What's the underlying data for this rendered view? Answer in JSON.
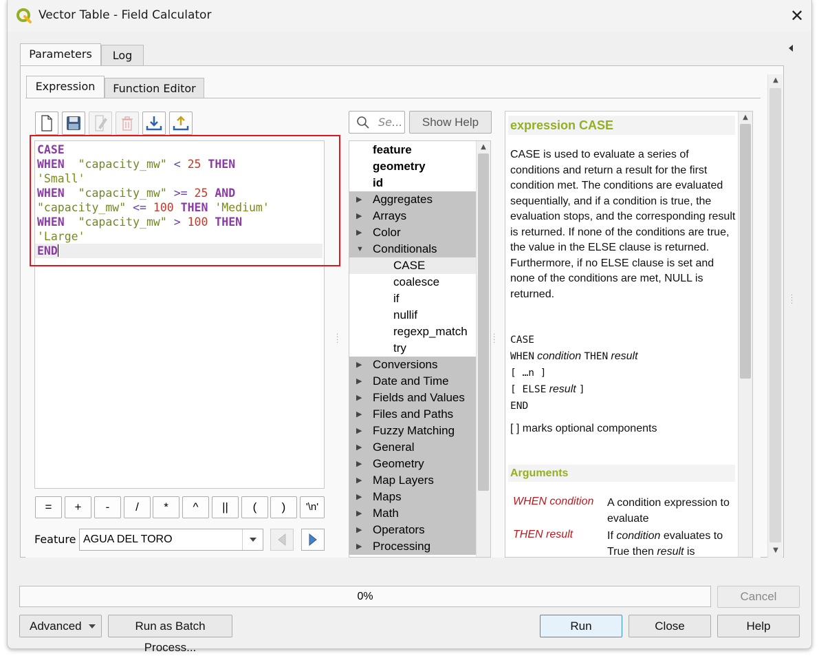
{
  "window": {
    "title": "Vector Table - Field Calculator",
    "close_glyph": "✕"
  },
  "tabs_outer": [
    {
      "label": "Parameters"
    },
    {
      "label": "Log"
    }
  ],
  "tabs_inner": [
    {
      "label": "Expression"
    },
    {
      "label": "Function Editor"
    }
  ],
  "toolbar_icons": [
    "new-file-icon",
    "save-icon",
    "edit-icon",
    "delete-icon",
    "import-icon",
    "export-icon"
  ],
  "expression": {
    "lines": [
      [
        {
          "t": "CASE",
          "c": "kw"
        }
      ],
      [
        {
          "t": "WHEN",
          "c": "kw"
        },
        {
          "t": "  ",
          "c": ""
        },
        {
          "t": "\"capacity_mw\"",
          "c": "fld"
        },
        {
          "t": " ",
          "c": ""
        },
        {
          "t": "<",
          "c": "op"
        },
        {
          "t": " ",
          "c": ""
        },
        {
          "t": "25",
          "c": "num"
        },
        {
          "t": " ",
          "c": ""
        },
        {
          "t": "THEN",
          "c": "kw"
        }
      ],
      [
        {
          "t": "'Small'",
          "c": "str"
        }
      ],
      [
        {
          "t": "WHEN",
          "c": "kw"
        },
        {
          "t": "  ",
          "c": ""
        },
        {
          "t": "\"capacity_mw\"",
          "c": "fld"
        },
        {
          "t": " ",
          "c": ""
        },
        {
          "t": ">=",
          "c": "op"
        },
        {
          "t": " ",
          "c": ""
        },
        {
          "t": "25",
          "c": "num"
        },
        {
          "t": " ",
          "c": ""
        },
        {
          "t": "AND",
          "c": "kw"
        }
      ],
      [
        {
          "t": "\"capacity_mw\"",
          "c": "fld"
        },
        {
          "t": " ",
          "c": ""
        },
        {
          "t": "<=",
          "c": "op"
        },
        {
          "t": " ",
          "c": ""
        },
        {
          "t": "100",
          "c": "num"
        },
        {
          "t": " ",
          "c": ""
        },
        {
          "t": "THEN",
          "c": "kw"
        },
        {
          "t": " ",
          "c": ""
        },
        {
          "t": "'Medium'",
          "c": "str"
        }
      ],
      [
        {
          "t": "WHEN",
          "c": "kw"
        },
        {
          "t": "  ",
          "c": ""
        },
        {
          "t": "\"capacity_mw\"",
          "c": "fld"
        },
        {
          "t": " ",
          "c": ""
        },
        {
          "t": ">",
          "c": "op"
        },
        {
          "t": " ",
          "c": ""
        },
        {
          "t": "100",
          "c": "num"
        },
        {
          "t": " ",
          "c": ""
        },
        {
          "t": "THEN",
          "c": "kw"
        }
      ],
      [
        {
          "t": "'Large'",
          "c": "str"
        }
      ],
      [
        {
          "t": "END",
          "c": "kw"
        }
      ]
    ]
  },
  "operators": [
    "=",
    "+",
    "-",
    "/",
    "*",
    "^",
    "||",
    "(",
    ")",
    "'\\n'"
  ],
  "feature": {
    "label": "Feature",
    "value": "AGUA DEL TORO"
  },
  "search": {
    "placeholder": "Se..."
  },
  "show_help_label": "Show Help",
  "function_tree": [
    {
      "label": "feature",
      "type": "bold"
    },
    {
      "label": "geometry",
      "type": "bold"
    },
    {
      "label": "id",
      "type": "bold"
    },
    {
      "label": "Aggregates",
      "type": "group",
      "expanded": false
    },
    {
      "label": "Arrays",
      "type": "group",
      "expanded": false
    },
    {
      "label": "Color",
      "type": "group",
      "expanded": false
    },
    {
      "label": "Conditionals",
      "type": "group",
      "expanded": true
    },
    {
      "label": "CASE",
      "type": "child",
      "selected": true
    },
    {
      "label": "coalesce",
      "type": "child"
    },
    {
      "label": "if",
      "type": "child"
    },
    {
      "label": "nullif",
      "type": "child"
    },
    {
      "label": "regexp_match",
      "type": "child"
    },
    {
      "label": "try",
      "type": "child"
    },
    {
      "label": "Conversions",
      "type": "group",
      "expanded": false
    },
    {
      "label": "Date and Time",
      "type": "group",
      "expanded": false
    },
    {
      "label": "Fields and Values",
      "type": "group",
      "expanded": false
    },
    {
      "label": "Files and Paths",
      "type": "group",
      "expanded": false
    },
    {
      "label": "Fuzzy Matching",
      "type": "group",
      "expanded": false
    },
    {
      "label": "General",
      "type": "group",
      "expanded": false
    },
    {
      "label": "Geometry",
      "type": "group",
      "expanded": false
    },
    {
      "label": "Map Layers",
      "type": "group",
      "expanded": false
    },
    {
      "label": "Maps",
      "type": "group",
      "expanded": false
    },
    {
      "label": "Math",
      "type": "group",
      "expanded": false
    },
    {
      "label": "Operators",
      "type": "group",
      "expanded": false
    },
    {
      "label": "Processing",
      "type": "group",
      "expanded": false
    }
  ],
  "help": {
    "title": "expression CASE",
    "description": "CASE is used to evaluate a series of conditions and return a result for the first condition met. The conditions are evaluated sequentially, and if a condition is true, the evaluation stops, and the corresponding result is returned. If none of the conditions are true, the value in the ELSE clause is returned. Furthermore, if no ELSE clause is set and none of the conditions are met, NULL is returned.",
    "syntax": {
      "l1": "CASE",
      "l2_kw": "WHEN",
      "l2_a": "condition",
      "l2_kw2": "THEN",
      "l2_b": "result",
      "l3": "[ …n ]",
      "l4_open": "[ ELSE",
      "l4_a": "result",
      "l4_close": "]",
      "l5": "END"
    },
    "optional_note": "[ ] marks optional components",
    "arguments_title": "Arguments",
    "args": [
      {
        "name": "WHEN condition",
        "desc": "A condition expression to evaluate"
      },
      {
        "name": "THEN result",
        "desc_pre": "If ",
        "desc_em": "condition",
        "desc_mid": " evaluates to True then ",
        "desc_em2": "result",
        "desc_post": " is"
      }
    ]
  },
  "progress": {
    "value": 0,
    "label": "0%"
  },
  "buttons": {
    "cancel": "Cancel",
    "advanced": "Advanced",
    "batch": "Run as Batch Process...",
    "run": "Run",
    "close": "Close",
    "help": "Help"
  },
  "colors": {
    "keyword": "#8b3aa6",
    "field": "#6d8a1f",
    "string": "#7b8a17",
    "number": "#c23a2b",
    "help_heading": "#93b023",
    "arg_name": "#c0171d",
    "highlight_border": "#e0161b"
  }
}
